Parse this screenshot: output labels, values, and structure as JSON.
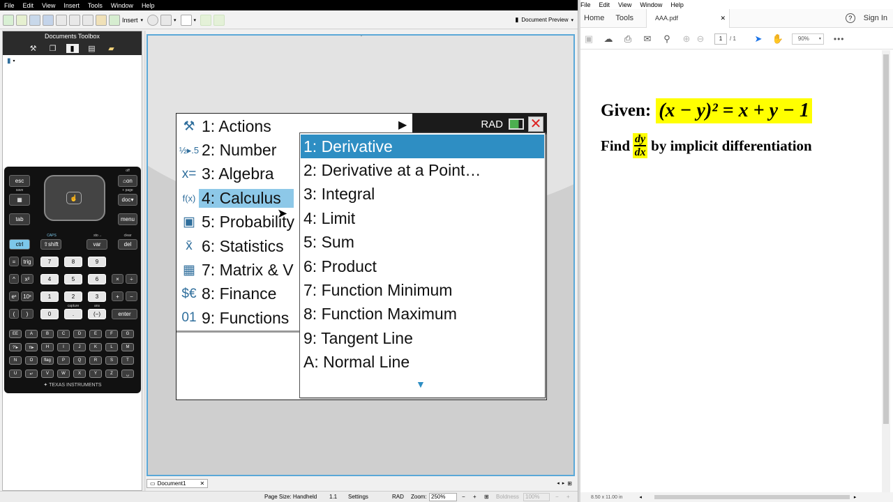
{
  "app_menu": [
    "File",
    "Edit",
    "View",
    "Insert",
    "Tools",
    "Window",
    "Help"
  ],
  "toolbar": {
    "insert_label": "Insert",
    "doc_preview_label": "Document Preview"
  },
  "toolbox": {
    "title": "Documents Toolbox"
  },
  "calculator": {
    "brand": "TEXAS INSTRUMENTS",
    "keys": {
      "esc": "esc",
      "on": "on",
      "doc": "doc",
      "menu": "menu",
      "tab": "tab",
      "ctrl": "ctrl",
      "shift": "shift",
      "var": "var",
      "del": "del",
      "eq": "=",
      "trig": "trig",
      "caret": "^",
      "x2": "x²",
      "ex": "eˣ",
      "tenx": "10ˣ",
      "lparen": "(",
      "rparen": ")",
      "n7": "7",
      "n8": "8",
      "n9": "9",
      "n4": "4",
      "n5": "5",
      "n6": "6",
      "n1": "1",
      "n2": "2",
      "n3": "3",
      "n0": "0",
      "dot": ".",
      "neg": "(−)",
      "enter": "enter",
      "mul": "×",
      "div": "÷",
      "plus": "+",
      "minus": "−"
    },
    "letters": [
      "EE",
      "A",
      "B",
      "C",
      "D",
      "E",
      "F",
      "G",
      "?!▸",
      "π▸",
      "H",
      "I",
      "J",
      "K",
      "L",
      "M",
      "N",
      "O",
      "flag",
      "P",
      "Q",
      "R",
      "S",
      "T",
      "U",
      "↵",
      "V",
      "W",
      "X",
      "Y",
      "Z",
      "␣"
    ],
    "labels": {
      "caps": "CAPS",
      "sto": "sto→",
      "clear": "clear",
      "save": "save",
      "off": "off",
      "page": "+ page",
      "capture": "capture",
      "ans": "ans"
    }
  },
  "screen": {
    "status_mode": "RAD",
    "menu_items": [
      {
        "label": "1: Actions",
        "icon": "actions-icon",
        "glyph": "⚒"
      },
      {
        "label": "2: Number",
        "icon": "number-icon",
        "glyph": "½▸.5"
      },
      {
        "label": "3: Algebra",
        "icon": "algebra-icon",
        "glyph": "x="
      },
      {
        "label": "4: Calculus",
        "icon": "calculus-icon",
        "glyph": "f(x)"
      },
      {
        "label": "5: Probability",
        "icon": "probability-icon",
        "glyph": "▣"
      },
      {
        "label": "6: Statistics",
        "icon": "statistics-icon",
        "glyph": "x̄"
      },
      {
        "label": "7: Matrix & V",
        "icon": "matrix-icon",
        "glyph": "▦"
      },
      {
        "label": "8: Finance",
        "icon": "finance-icon",
        "glyph": "$€"
      },
      {
        "label": "9: Functions",
        "icon": "functions-icon",
        "glyph": "01"
      }
    ],
    "submenu_items": [
      "1: Derivative",
      "2: Derivative at a Point…",
      "3: Integral",
      "4: Limit",
      "5: Sum",
      "6: Product",
      "7: Function Minimum",
      "8: Function Maximum",
      "9: Tangent Line",
      "A: Normal Line"
    ]
  },
  "doc_tab": {
    "label": "Document1"
  },
  "statusbar": {
    "page_size": "Page Size: Handheld",
    "page_num": "1.1",
    "settings": "Settings",
    "mode": "RAD",
    "zoom_label": "Zoom:",
    "zoom_value": "250%",
    "boldness_label": "Boldness",
    "boldness_value": "100%"
  },
  "pdf": {
    "menu": [
      "File",
      "Edit",
      "View",
      "Window",
      "Help"
    ],
    "tabs": {
      "home": "Home",
      "tools": "Tools",
      "file": "AAA.pdf",
      "signin": "Sign In"
    },
    "page_current": "1",
    "page_total": "/ 1",
    "zoom": "90%",
    "page_size": "8.50 x 11.00 in",
    "line1_prefix": "Given:",
    "equation": "(x − y)² = x + y − 1",
    "line2_prefix": "Find",
    "frac_num": "dy",
    "frac_den": "dx",
    "line2_suffix": "by implicit differentiation"
  }
}
